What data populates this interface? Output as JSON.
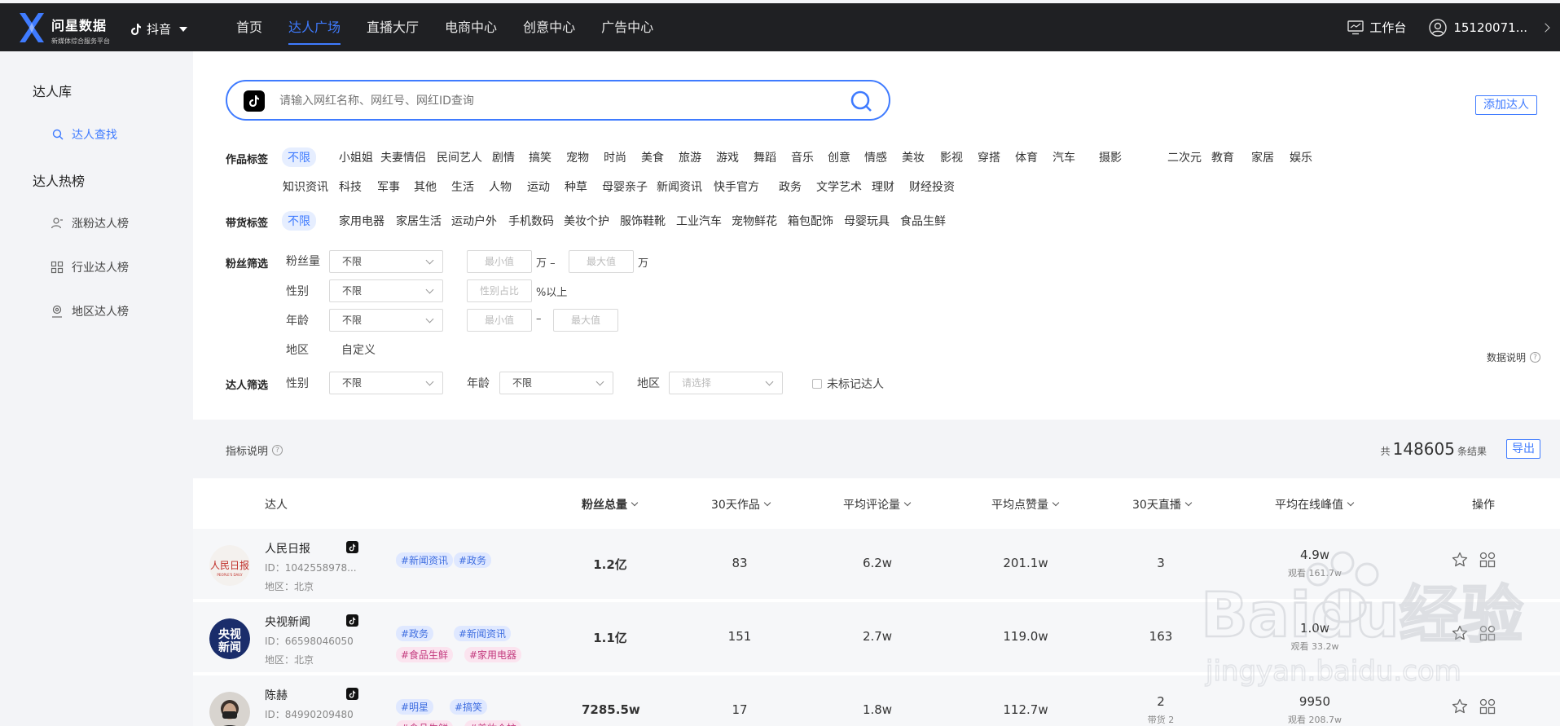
{
  "topbar": {
    "logo_title": "问星数据",
    "logo_sub": "新媒体综合服务平台",
    "platform": "抖音",
    "nav": [
      "首页",
      "达人广场",
      "直播大厅",
      "电商中心",
      "创意中心",
      "广告中心"
    ],
    "active_nav": "达人广场",
    "workbench": "工作台",
    "user": "15120071..."
  },
  "sidebar": {
    "group1": "达人库",
    "item_search": "达人查找",
    "group2": "达人热榜",
    "item_fans": "涨粉达人榜",
    "item_industry": "行业达人榜",
    "item_region": "地区达人榜"
  },
  "search": {
    "placeholder": "请输入网红名称、网红号、网红ID查询",
    "add_button": "添加达人"
  },
  "filters": {
    "work_tags_label": "作品标签",
    "work_tags_row1": [
      "不限",
      "小姐姐",
      "夫妻情侣",
      "民间艺人",
      "剧情",
      "搞笑",
      "宠物",
      "时尚",
      "美食",
      "旅游",
      "游戏",
      "舞蹈",
      "音乐",
      "创意",
      "情感",
      "美妆",
      "影视",
      "穿搭",
      "体育",
      "汽车",
      "摄影",
      "二次元",
      "教育",
      "家居",
      "娱乐"
    ],
    "work_tags_row2": [
      "知识资讯",
      "科技",
      "军事",
      "其他",
      "生活",
      "人物",
      "运动",
      "种草",
      "母婴亲子",
      "新闻资讯",
      "快手官方",
      "政务",
      "文学艺术",
      "理财",
      "财经投资"
    ],
    "goods_tags_label": "带货标签",
    "goods_tags": [
      "不限",
      "家用电器",
      "家居生活",
      "运动户外",
      "手机数码",
      "美妆个护",
      "服饰鞋靴",
      "工业汽车",
      "宠物鲜花",
      "箱包配饰",
      "母婴玩具",
      "食品生鲜"
    ],
    "fans_label": "粉丝筛选",
    "fans_count_label": "粉丝量",
    "fans_count_value": "不限",
    "min_placeholder": "最小值",
    "max_placeholder": "最大值",
    "unit_wan_dash": "万 –",
    "unit_wan": "万",
    "gender_label": "性别",
    "gender_value": "不限",
    "gender_ratio_placeholder": "性别占比",
    "gender_ratio_unit": "%以上",
    "age_label": "年龄",
    "age_value": "不限",
    "age_dash": "–",
    "region_label": "地区",
    "region_value": "自定义",
    "kol_label": "达人筛选",
    "kol_gender_label": "性别",
    "kol_gender_value": "不限",
    "kol_age_label": "年龄",
    "kol_age_value": "不限",
    "kol_region_label": "地区",
    "kol_region_placeholder": "请选择",
    "unmarked": "未标记达人",
    "data_note": "数据说明"
  },
  "results": {
    "metric_note": "指标说明",
    "total_prefix": "共",
    "total_count": "148605",
    "total_suffix": "条结果",
    "export": "导出"
  },
  "table": {
    "headers": {
      "kol": "达人",
      "fans": "粉丝总量",
      "works30": "30天作品",
      "avg_comment": "平均评论量",
      "avg_like": "平均点赞量",
      "live30": "30天直播",
      "avg_online_peak": "平均在线峰值",
      "ops": "操作"
    },
    "rows": [
      {
        "name": "人民日报",
        "id": "ID：1042558978...",
        "region": "地区：北京",
        "tags": [
          {
            "text": "#新闻资讯",
            "type": "blue"
          },
          {
            "text": "#政务",
            "type": "blue"
          }
        ],
        "fans": "1.2亿",
        "works30": "83",
        "avg_comment": "6.2w",
        "avg_like": "201.1w",
        "live30": "3",
        "live_sub": "",
        "peak": "4.9w",
        "peak_sub": "观看 161.7w"
      },
      {
        "name": "央视新闻",
        "id": "ID：66598046050",
        "region": "地区：北京",
        "tags": [
          {
            "text": "#政务",
            "type": "blue"
          },
          {
            "text": "#新闻资讯",
            "type": "blue"
          },
          {
            "text": "#食品生鲜",
            "type": "pink"
          },
          {
            "text": "#家用电器",
            "type": "pink"
          }
        ],
        "fans": "1.1亿",
        "works30": "151",
        "avg_comment": "2.7w",
        "avg_like": "119.0w",
        "live30": "163",
        "live_sub": "",
        "peak": "1.0w",
        "peak_sub": "观看 33.2w"
      },
      {
        "name": "陈赫",
        "id": "ID：84990209480",
        "region": "",
        "tags": [
          {
            "text": "#明星",
            "type": "blue"
          },
          {
            "text": "#搞笑",
            "type": "blue"
          },
          {
            "text": "#食品生鲜",
            "type": "pink"
          },
          {
            "text": "#美妆个护",
            "type": "pink"
          }
        ],
        "fans": "7285.5w",
        "works30": "17",
        "avg_comment": "1.8w",
        "avg_like": "112.7w",
        "live30": "2",
        "live_sub": "带货 2",
        "peak": "9950",
        "peak_sub": "观看 208.7w"
      }
    ]
  },
  "watermark": {
    "text": "Baidu经验",
    "url": "jingyan.baidu.com"
  },
  "colors": {
    "accent": "#3f7bff",
    "topbar": "#1f2023",
    "tag_blue_bg": "#dfe8ff",
    "tag_pink_bg": "#fbe4ef"
  }
}
